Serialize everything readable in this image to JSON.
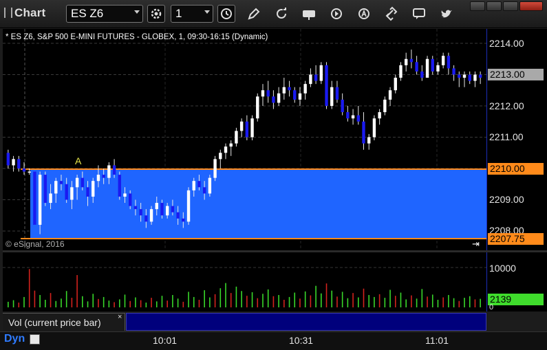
{
  "window": {
    "app_title": "Chart",
    "symbol": "ES Z6",
    "interval": "1"
  },
  "chart": {
    "title": "* ES Z6, S&P 500 E-MINI FUTURES - GLOBEX, 1, 09:30-16:15 (Dynamic)",
    "copyright": "© eSignal, 2016",
    "marker_label": "A",
    "price_labels": [
      "2214.00",
      "2212.00",
      "2211.00",
      "2209.00",
      "2208.00"
    ],
    "last_price": "2213.00",
    "zone_upper": "2210.00",
    "zone_lower": "2207.75",
    "zone_color": "#1f65ff",
    "line_color": "#ff8a1a"
  },
  "volume": {
    "panel_label": "Vol (current price bar)",
    "axis_label": "10000",
    "zero_label": "0",
    "current_value": "2139",
    "up_color": "#39d82a",
    "down_color": "#d4221d"
  },
  "footer": {
    "mode_label": "Dyn",
    "time_labels": [
      "10:01",
      "10:31",
      "11:01"
    ]
  },
  "chart_data": {
    "type": "candlestick",
    "up_color": "#ffffff",
    "down_color": "#1a1af0",
    "x_ticks": [
      "10:01",
      "10:31",
      "11:01"
    ],
    "ylim": [
      2207.75,
      2214.4
    ],
    "bars": [
      [
        2210.5,
        2210.6,
        2210.0,
        2210.1
      ],
      [
        2210.1,
        2210.4,
        2209.9,
        2210.3
      ],
      [
        2210.3,
        2210.4,
        2209.9,
        2210.0
      ],
      [
        2210.0,
        2210.2,
        2209.8,
        2209.9
      ],
      [
        2209.9,
        2210.0,
        2209.8,
        2209.9
      ],
      [
        2209.9,
        2209.9,
        2208.2,
        2208.2
      ],
      [
        2208.2,
        2209.9,
        2207.9,
        2209.8
      ],
      [
        2209.8,
        2209.9,
        2208.8,
        2208.9
      ],
      [
        2208.9,
        2209.5,
        2208.7,
        2209.2
      ],
      [
        2209.2,
        2209.7,
        2208.9,
        2209.6
      ],
      [
        2209.6,
        2209.8,
        2209.3,
        2209.5
      ],
      [
        2209.5,
        2209.7,
        2208.9,
        2209.0
      ],
      [
        2209.0,
        2209.6,
        2208.7,
        2209.4
      ],
      [
        2209.4,
        2209.8,
        2209.0,
        2209.7
      ],
      [
        2209.7,
        2209.9,
        2209.3,
        2209.4
      ],
      [
        2209.4,
        2209.6,
        2208.8,
        2209.1
      ],
      [
        2209.1,
        2209.7,
        2208.9,
        2209.6
      ],
      [
        2209.6,
        2210.1,
        2209.4,
        2209.8
      ],
      [
        2209.8,
        2210.0,
        2209.5,
        2209.7
      ],
      [
        2209.7,
        2210.2,
        2209.5,
        2210.1
      ],
      [
        2210.1,
        2210.3,
        2209.7,
        2209.8
      ],
      [
        2209.8,
        2209.9,
        2209.0,
        2209.1
      ],
      [
        2209.1,
        2209.4,
        2208.9,
        2209.2
      ],
      [
        2209.2,
        2209.3,
        2208.7,
        2208.8
      ],
      [
        2208.8,
        2209.0,
        2208.5,
        2208.7
      ],
      [
        2208.7,
        2208.9,
        2208.3,
        2208.5
      ],
      [
        2208.5,
        2208.7,
        2208.1,
        2208.3
      ],
      [
        2208.3,
        2208.8,
        2208.2,
        2208.7
      ],
      [
        2208.7,
        2209.1,
        2208.5,
        2208.9
      ],
      [
        2208.9,
        2209.0,
        2208.4,
        2208.5
      ],
      [
        2208.5,
        2208.9,
        2208.4,
        2208.8
      ],
      [
        2208.8,
        2209.0,
        2208.5,
        2208.6
      ],
      [
        2208.6,
        2208.8,
        2208.2,
        2208.4
      ],
      [
        2208.4,
        2208.6,
        2208.1,
        2208.3
      ],
      [
        2208.3,
        2209.4,
        2208.2,
        2209.3
      ],
      [
        2209.3,
        2209.7,
        2209.1,
        2209.6
      ],
      [
        2209.6,
        2209.8,
        2209.3,
        2209.4
      ],
      [
        2209.4,
        2209.6,
        2209.0,
        2209.2
      ],
      [
        2209.2,
        2209.8,
        2209.1,
        2209.7
      ],
      [
        2209.7,
        2210.4,
        2209.6,
        2210.3
      ],
      [
        2210.3,
        2210.6,
        2210.0,
        2210.5
      ],
      [
        2210.5,
        2210.8,
        2210.3,
        2210.7
      ],
      [
        2210.7,
        2210.9,
        2210.4,
        2210.8
      ],
      [
        2210.8,
        2211.3,
        2210.7,
        2211.2
      ],
      [
        2211.2,
        2211.6,
        2211.0,
        2211.5
      ],
      [
        2211.5,
        2211.7,
        2210.9,
        2211.0
      ],
      [
        2211.0,
        2211.7,
        2210.9,
        2211.6
      ],
      [
        2211.6,
        2212.4,
        2211.5,
        2212.3
      ],
      [
        2212.3,
        2212.7,
        2212.0,
        2212.5
      ],
      [
        2212.5,
        2212.8,
        2212.1,
        2212.3
      ],
      [
        2212.3,
        2212.5,
        2211.9,
        2212.1
      ],
      [
        2212.1,
        2212.6,
        2212.0,
        2212.4
      ],
      [
        2212.4,
        2212.9,
        2212.2,
        2212.6
      ],
      [
        2212.6,
        2212.8,
        2212.3,
        2212.5
      ],
      [
        2212.5,
        2212.6,
        2212.1,
        2212.2
      ],
      [
        2212.2,
        2212.6,
        2212.0,
        2212.4
      ],
      [
        2212.4,
        2212.8,
        2212.2,
        2212.7
      ],
      [
        2212.7,
        2213.2,
        2212.6,
        2213.0
      ],
      [
        2213.0,
        2213.3,
        2212.7,
        2212.8
      ],
      [
        2212.8,
        2213.4,
        2212.7,
        2213.3
      ],
      [
        2213.3,
        2213.4,
        2211.9,
        2212.0
      ],
      [
        2212.0,
        2212.8,
        2211.9,
        2212.6
      ],
      [
        2212.6,
        2212.8,
        2212.1,
        2212.2
      ],
      [
        2212.2,
        2212.4,
        2211.7,
        2211.8
      ],
      [
        2211.8,
        2212.0,
        2211.5,
        2211.6
      ],
      [
        2211.6,
        2211.9,
        2211.4,
        2211.7
      ],
      [
        2211.7,
        2212.0,
        2211.4,
        2211.5
      ],
      [
        2211.5,
        2211.8,
        2210.6,
        2210.8
      ],
      [
        2210.8,
        2211.1,
        2210.6,
        2211.0
      ],
      [
        2211.0,
        2211.7,
        2210.9,
        2211.6
      ],
      [
        2211.6,
        2211.9,
        2211.4,
        2211.8
      ],
      [
        2211.8,
        2212.3,
        2211.7,
        2212.2
      ],
      [
        2212.2,
        2212.6,
        2212.0,
        2212.5
      ],
      [
        2212.5,
        2213.0,
        2212.4,
        2212.9
      ],
      [
        2212.9,
        2213.4,
        2212.8,
        2213.3
      ],
      [
        2213.3,
        2213.7,
        2213.1,
        2213.5
      ],
      [
        2213.5,
        2213.8,
        2213.2,
        2213.4
      ],
      [
        2213.4,
        2213.6,
        2213.0,
        2213.1
      ],
      [
        2213.1,
        2213.3,
        2212.8,
        2212.9
      ],
      [
        2212.9,
        2213.6,
        2212.9,
        2213.5
      ],
      [
        2213.5,
        2213.6,
        2213.0,
        2213.1
      ],
      [
        2213.1,
        2213.4,
        2213.0,
        2213.3
      ],
      [
        2213.3,
        2213.7,
        2213.2,
        2213.6
      ],
      [
        2213.6,
        2213.7,
        2213.0,
        2213.2
      ],
      [
        2213.2,
        2213.3,
        2212.8,
        2213.0
      ],
      [
        2213.0,
        2213.1,
        2212.6,
        2212.9
      ],
      [
        2212.9,
        2213.1,
        2212.6,
        2213.0
      ],
      [
        2213.0,
        2213.1,
        2212.7,
        2212.8
      ],
      [
        2212.8,
        2213.1,
        2212.6,
        2213.0
      ],
      [
        2213.0,
        2213.1,
        2212.7,
        2212.9
      ]
    ],
    "volume": [
      {
        "v": 1400,
        "up": true
      },
      {
        "v": 1800,
        "up": true
      },
      {
        "v": 1200,
        "up": false
      },
      {
        "v": 2600,
        "up": true
      },
      {
        "v": 9600,
        "up": false
      },
      {
        "v": 4200,
        "up": false
      },
      {
        "v": 3100,
        "up": true
      },
      {
        "v": 1900,
        "up": true
      },
      {
        "v": 3600,
        "up": false
      },
      {
        "v": 1600,
        "up": true
      },
      {
        "v": 2200,
        "up": true
      },
      {
        "v": 4100,
        "up": true
      },
      {
        "v": 2400,
        "up": false
      },
      {
        "v": 8100,
        "up": false
      },
      {
        "v": 2800,
        "up": true
      },
      {
        "v": 1500,
        "up": true
      },
      {
        "v": 3400,
        "up": true
      },
      {
        "v": 2100,
        "up": false
      },
      {
        "v": 2600,
        "up": true
      },
      {
        "v": 1700,
        "up": true
      },
      {
        "v": 1300,
        "up": false
      },
      {
        "v": 2000,
        "up": true
      },
      {
        "v": 3200,
        "up": true
      },
      {
        "v": 1600,
        "up": false
      },
      {
        "v": 2500,
        "up": true
      },
      {
        "v": 1800,
        "up": false
      },
      {
        "v": 1200,
        "up": true
      },
      {
        "v": 2400,
        "up": false
      },
      {
        "v": 1500,
        "up": true
      },
      {
        "v": 2900,
        "up": true
      },
      {
        "v": 1700,
        "up": false
      },
      {
        "v": 3100,
        "up": true
      },
      {
        "v": 2200,
        "up": true
      },
      {
        "v": 1400,
        "up": false
      },
      {
        "v": 3900,
        "up": true
      },
      {
        "v": 2600,
        "up": true
      },
      {
        "v": 1900,
        "up": false
      },
      {
        "v": 4300,
        "up": true
      },
      {
        "v": 2500,
        "up": true
      },
      {
        "v": 3300,
        "up": false
      },
      {
        "v": 4800,
        "up": true
      },
      {
        "v": 6100,
        "up": true
      },
      {
        "v": 3600,
        "up": false
      },
      {
        "v": 5200,
        "up": true
      },
      {
        "v": 4100,
        "up": true
      },
      {
        "v": 2900,
        "up": false
      },
      {
        "v": 3800,
        "up": true
      },
      {
        "v": 2300,
        "up": false
      },
      {
        "v": 3400,
        "up": true
      },
      {
        "v": 4500,
        "up": true
      },
      {
        "v": 2800,
        "up": false
      },
      {
        "v": 3100,
        "up": true
      },
      {
        "v": 1900,
        "up": false
      },
      {
        "v": 2600,
        "up": true
      },
      {
        "v": 3700,
        "up": true
      },
      {
        "v": 2200,
        "up": false
      },
      {
        "v": 4000,
        "up": true
      },
      {
        "v": 3000,
        "up": false
      },
      {
        "v": 5400,
        "up": true
      },
      {
        "v": 3500,
        "up": true
      },
      {
        "v": 6000,
        "up": false
      },
      {
        "v": 4200,
        "up": true
      },
      {
        "v": 2700,
        "up": false
      },
      {
        "v": 3900,
        "up": true
      },
      {
        "v": 2300,
        "up": true
      },
      {
        "v": 3600,
        "up": false
      },
      {
        "v": 2500,
        "up": true
      },
      {
        "v": 4700,
        "up": false
      },
      {
        "v": 3100,
        "up": true
      },
      {
        "v": 2600,
        "up": true
      },
      {
        "v": 3300,
        "up": false
      },
      {
        "v": 2400,
        "up": true
      },
      {
        "v": 4400,
        "up": true
      },
      {
        "v": 2900,
        "up": false
      },
      {
        "v": 3700,
        "up": true
      },
      {
        "v": 2000,
        "up": true
      },
      {
        "v": 3000,
        "up": false
      },
      {
        "v": 2200,
        "up": true
      },
      {
        "v": 4600,
        "up": true
      },
      {
        "v": 2700,
        "up": false
      },
      {
        "v": 3200,
        "up": true
      },
      {
        "v": 1900,
        "up": true
      },
      {
        "v": 2500,
        "up": false
      },
      {
        "v": 3100,
        "up": true
      },
      {
        "v": 2300,
        "up": true
      },
      {
        "v": 1600,
        "up": false
      },
      {
        "v": 2400,
        "up": true
      },
      {
        "v": 2800,
        "up": true
      },
      {
        "v": 2000,
        "up": false
      },
      {
        "v": 2139,
        "up": true
      }
    ]
  }
}
